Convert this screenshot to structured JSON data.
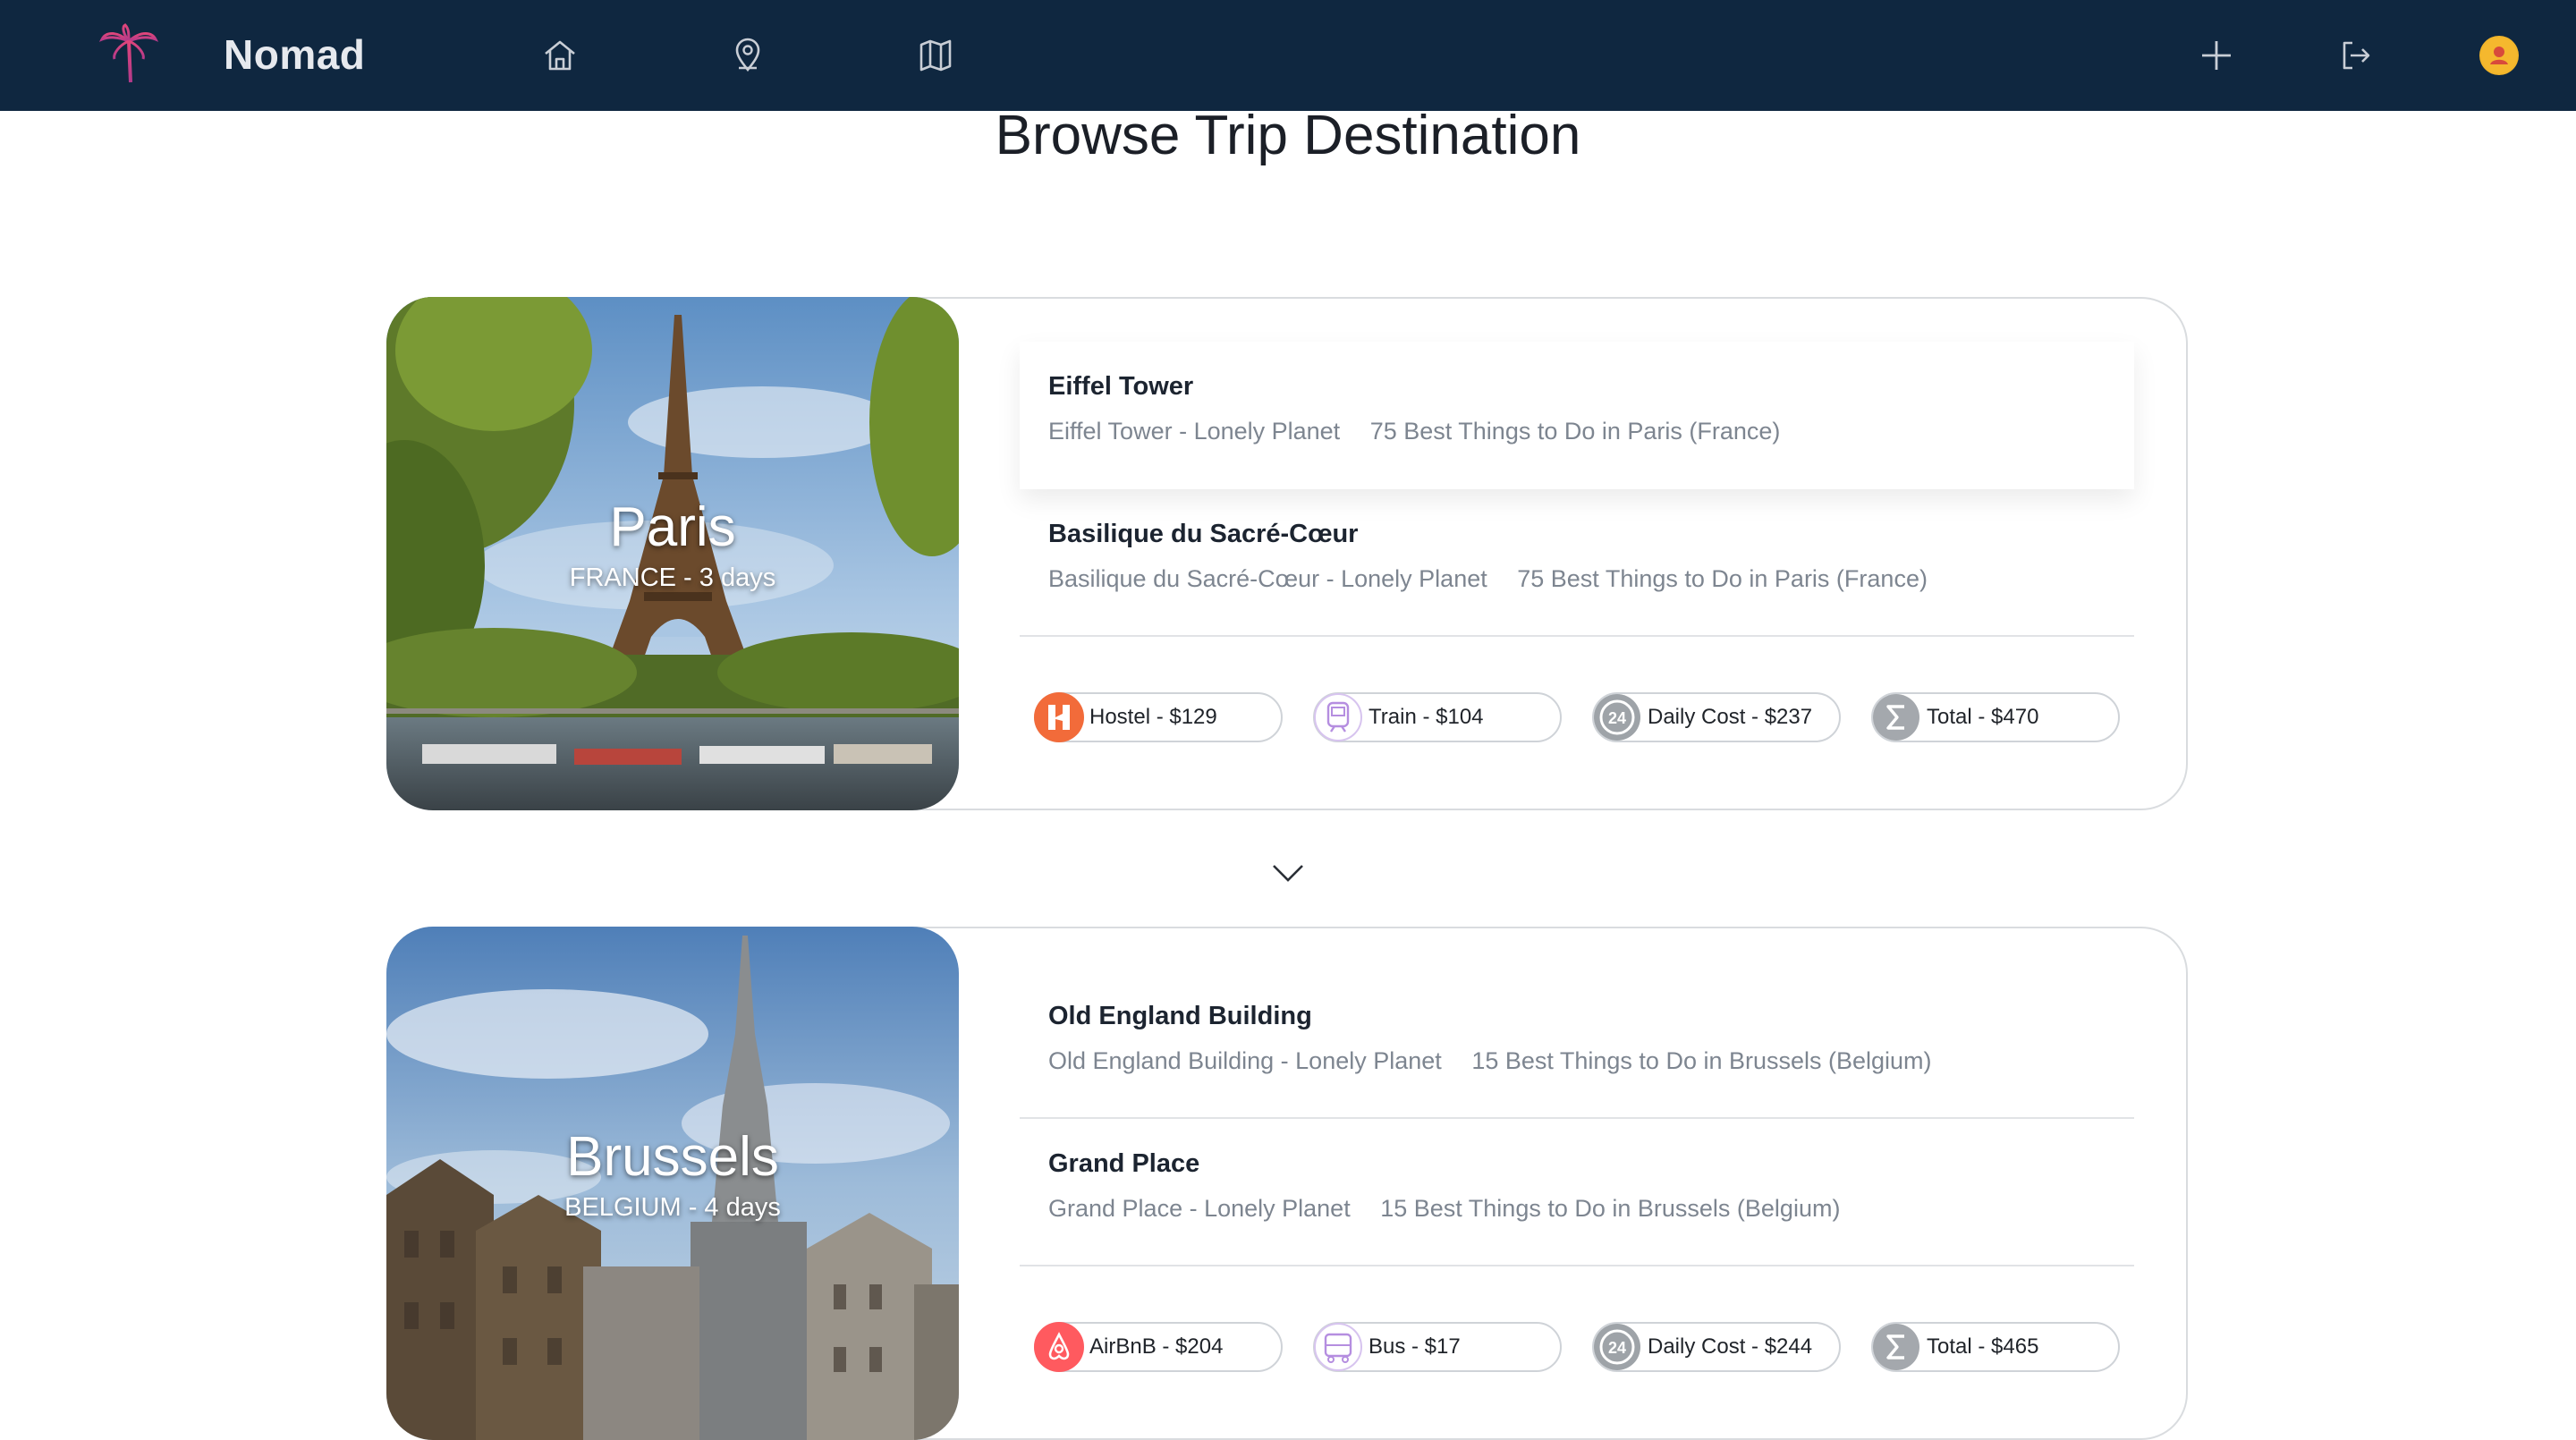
{
  "app": {
    "brand": "Nomad"
  },
  "nav": {
    "icons": [
      "home-icon",
      "location-pin-icon",
      "map-icon",
      "plus-icon",
      "logout-icon",
      "user-avatar-icon"
    ]
  },
  "page": {
    "title": "Browse Trip Destination"
  },
  "trips": [
    {
      "city": "Paris",
      "subtitle": "FRANCE - 3 days",
      "attractions": [
        {
          "name": "Eiffel Tower",
          "links": [
            "Eiffel Tower - Lonely Planet",
            "75 Best Things to Do in Paris (France)"
          ]
        },
        {
          "name": "Basilique du Sacré-Cœur",
          "links": [
            "Basilique du Sacré-Cœur - Lonely Planet",
            "75 Best Things to Do in Paris (France)"
          ]
        }
      ],
      "costs": [
        {
          "label": "Hostel - $129",
          "icon": "hostel-icon"
        },
        {
          "label": "Train - $104",
          "icon": "train-icon"
        },
        {
          "label": "Daily Cost - $237",
          "icon": "24h-icon"
        },
        {
          "label": "Total - $470",
          "icon": "sigma-icon"
        }
      ]
    },
    {
      "city": "Brussels",
      "subtitle": "BELGIUM - 4 days",
      "attractions": [
        {
          "name": "Old England Building",
          "links": [
            "Old England Building - Lonely Planet",
            "15 Best Things to Do in Brussels (Belgium)"
          ]
        },
        {
          "name": "Grand Place",
          "links": [
            "Grand Place - Lonely Planet",
            "15 Best Things to Do in Brussels (Belgium)"
          ]
        }
      ],
      "costs": [
        {
          "label": "AirBnB - $204",
          "icon": "airbnb-icon"
        },
        {
          "label": "Bus - $17",
          "icon": "bus-icon"
        },
        {
          "label": "Daily Cost - $244",
          "icon": "24h-icon"
        },
        {
          "label": "Total - $465",
          "icon": "sigma-icon"
        }
      ]
    }
  ],
  "colors": {
    "nav_bg": "#0f2740",
    "accent_pink": "#e0457b",
    "hostel_orange": "#f26b3a",
    "airbnb_red": "#ff5a5f"
  }
}
